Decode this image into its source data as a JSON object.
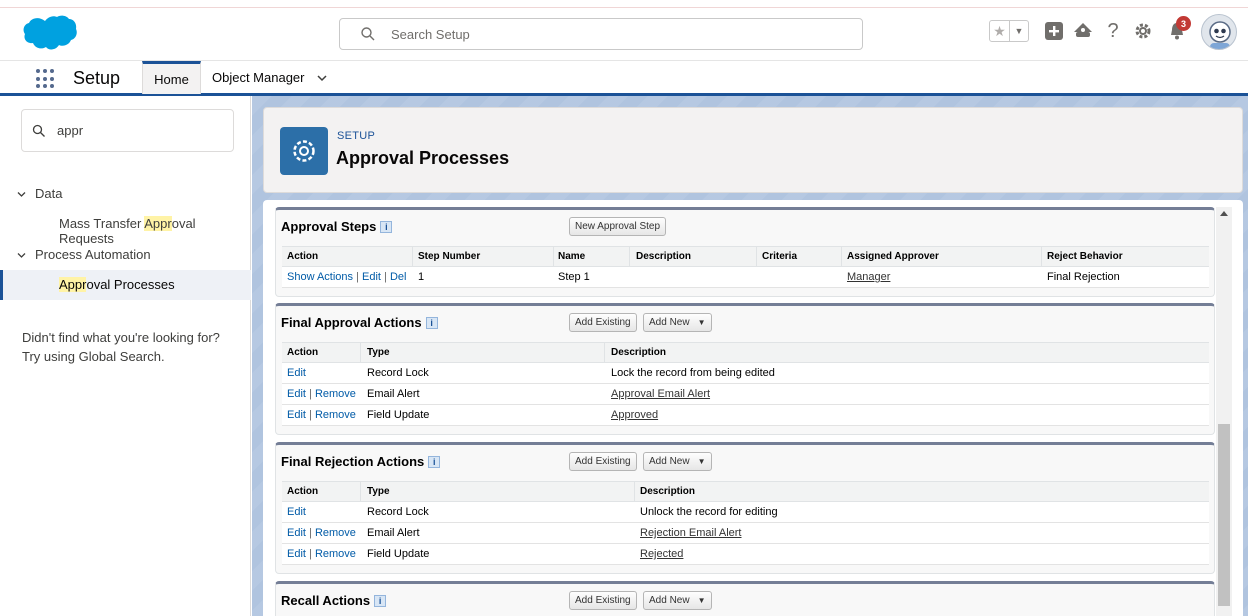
{
  "header": {
    "search_placeholder": "Search Setup",
    "notification_count": "3"
  },
  "context": {
    "app_name": "Setup",
    "tabs": [
      {
        "label": "Home"
      },
      {
        "label": "Object Manager"
      }
    ]
  },
  "sidebar": {
    "quickfind_value": "appr",
    "groups": [
      {
        "label": "Data",
        "items": [
          {
            "prefix": "Mass Transfer ",
            "match": "Appr",
            "suffix": "oval Requests"
          }
        ]
      },
      {
        "label": "Process Automation",
        "items": [
          {
            "prefix": "",
            "match": "Appr",
            "suffix": "oval Processes"
          }
        ]
      }
    ],
    "not_found_line1": "Didn't find what you're looking for?",
    "not_found_line2": "Try using Global Search."
  },
  "page": {
    "eyebrow": "SETUP",
    "title": "Approval Processes"
  },
  "approval_steps": {
    "title": "Approval Steps",
    "new_button": "New Approval Step",
    "columns": [
      "Action",
      "Step Number",
      "Name",
      "Description",
      "Criteria",
      "Assigned Approver",
      "Reject Behavior"
    ],
    "rows": [
      {
        "action_show": "Show Actions",
        "action_edit": "Edit",
        "action_del": "Del",
        "step_number": "1",
        "name": "Step 1",
        "description": "",
        "criteria": "",
        "approver": "Manager",
        "reject_behavior": "Final Rejection"
      }
    ]
  },
  "final_approval": {
    "title": "Final Approval Actions",
    "add_existing": "Add Existing",
    "add_new": "Add New",
    "columns": [
      "Action",
      "Type",
      "Description"
    ],
    "rows": [
      {
        "edit": "Edit",
        "remove": "",
        "type": "Record Lock",
        "description": "Lock the record from being edited"
      },
      {
        "edit": "Edit",
        "remove": "Remove",
        "type": "Email Alert",
        "description": "Approval Email Alert"
      },
      {
        "edit": "Edit",
        "remove": "Remove",
        "type": "Field Update",
        "description": "Approved"
      }
    ]
  },
  "final_rejection": {
    "title": "Final Rejection Actions",
    "add_existing": "Add Existing",
    "add_new": "Add New",
    "columns": [
      "Action",
      "Type",
      "Description"
    ],
    "rows": [
      {
        "edit": "Edit",
        "remove": "",
        "type": "Record Lock",
        "description": "Unlock the record for editing"
      },
      {
        "edit": "Edit",
        "remove": "Remove",
        "type": "Email Alert",
        "description": "Rejection Email Alert"
      },
      {
        "edit": "Edit",
        "remove": "Remove",
        "type": "Field Update",
        "description": "Rejected"
      }
    ]
  },
  "recall": {
    "title": "Recall Actions",
    "add_existing": "Add Existing",
    "add_new": "Add New"
  },
  "colors": {
    "brand": "#1b5297",
    "link": "#015ba7",
    "logo": "#00a1e0",
    "badge": "#c23934",
    "background": "#b0c4df"
  },
  "icons": [
    "salesforce-logo",
    "search-icon",
    "star-icon",
    "chevron-down-icon",
    "add-icon",
    "trailhead-icon",
    "help-icon",
    "gear-icon",
    "bell-icon",
    "avatar",
    "app-launcher-icon",
    "settings-icon",
    "info-icon"
  ]
}
